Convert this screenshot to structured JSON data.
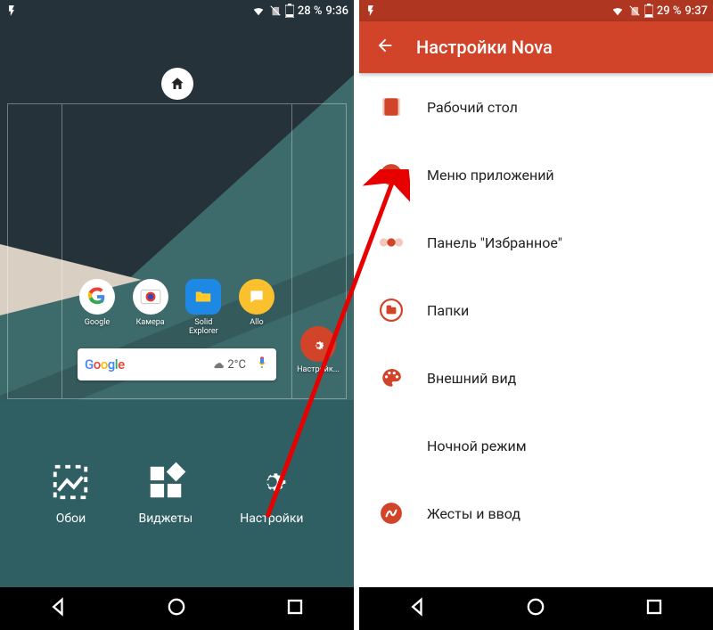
{
  "colors": {
    "accent": "#d14429",
    "accentDark": "#af3620",
    "teal": "#2f5f63"
  },
  "left": {
    "status": {
      "battery": "28 %",
      "time": "9:36"
    },
    "apps": [
      {
        "label": "Google"
      },
      {
        "label": "Камера"
      },
      {
        "label": "Solid Explorer"
      },
      {
        "label": "Allo"
      }
    ],
    "overflowApp": {
      "label": "Настройк..."
    },
    "search": {
      "logo": "Google",
      "weather": "2°C"
    },
    "quickActions": [
      {
        "label": "Обои"
      },
      {
        "label": "Виджеты"
      },
      {
        "label": "Настройки"
      }
    ]
  },
  "right": {
    "status": {
      "battery": "29 %",
      "time": "9:37"
    },
    "title": "Настройки Nova",
    "items": [
      {
        "icon": "desktop",
        "label": "Рабочий стол"
      },
      {
        "icon": "grid",
        "label": "Меню приложений"
      },
      {
        "icon": "dots",
        "label": "Панель \"Избранное\""
      },
      {
        "icon": "folder",
        "label": "Папки"
      },
      {
        "icon": "palette",
        "label": "Внешний вид"
      },
      {
        "icon": "moon",
        "label": "Ночной режим"
      },
      {
        "icon": "gesture",
        "label": "Жесты и ввод"
      }
    ]
  }
}
